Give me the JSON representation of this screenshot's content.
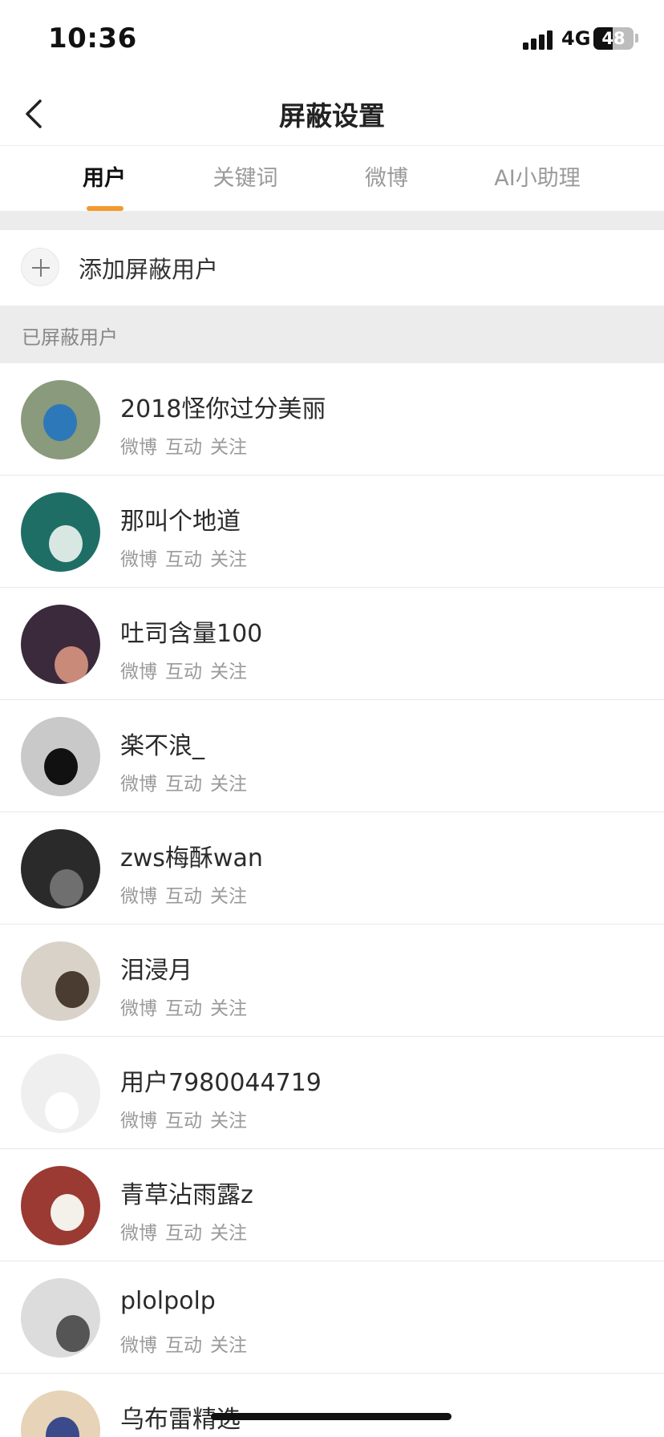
{
  "status_bar": {
    "time": "10:36",
    "network": "4G",
    "battery": "48",
    "battery_level": 0.48
  },
  "nav": {
    "title": "屏蔽设置",
    "back_icon": "chevron-left-icon"
  },
  "tabs": [
    {
      "label": "用户",
      "active": true
    },
    {
      "label": "关键词",
      "active": false
    },
    {
      "label": "微博",
      "active": false
    },
    {
      "label": "AI小助理",
      "active": false
    }
  ],
  "accent_color": "#f39a2c",
  "add_user": {
    "label": "添加屏蔽用户",
    "icon": "plus-icon"
  },
  "section": {
    "title": "已屏蔽用户"
  },
  "users": [
    {
      "name": "2018怪你过分美丽",
      "actions": [
        "微博",
        "互动",
        "关注"
      ],
      "avatar_bg": "#8a9a7c",
      "avatar_accent": "#2d78b8"
    },
    {
      "name": "那叫个地道",
      "actions": [
        "微博",
        "互动",
        "关注"
      ],
      "avatar_bg": "#1f6e66",
      "avatar_accent": "#d9e7e3"
    },
    {
      "name": "吐司含量100",
      "actions": [
        "微博",
        "互动",
        "关注"
      ],
      "avatar_bg": "#3a2a3c",
      "avatar_accent": "#c98a7a"
    },
    {
      "name": "楽不浪_",
      "actions": [
        "微博",
        "互动",
        "关注"
      ],
      "avatar_bg": "#c9c9c9",
      "avatar_accent": "#111111"
    },
    {
      "name": "zws梅酥wan",
      "actions": [
        "微博",
        "互动",
        "关注"
      ],
      "avatar_bg": "#2a2a2a",
      "avatar_accent": "#6f6f6f"
    },
    {
      "name": "泪浸月",
      "actions": [
        "微博",
        "互动",
        "关注"
      ],
      "avatar_bg": "#d8d2c8",
      "avatar_accent": "#4a3c30"
    },
    {
      "name": "用户7980044719",
      "actions": [
        "微博",
        "互动",
        "关注"
      ],
      "avatar_bg": "#efefef",
      "avatar_accent": "#ffffff"
    },
    {
      "name": "青草沾雨露z",
      "actions": [
        "微博",
        "互动",
        "关注"
      ],
      "avatar_bg": "#9a3a32",
      "avatar_accent": "#f3f1ea"
    },
    {
      "name": "plolpolp",
      "actions": [
        "微博",
        "互动",
        "关注"
      ],
      "avatar_bg": "#dcdcdc",
      "avatar_accent": "#555555"
    },
    {
      "name": "乌布雷精选",
      "actions": [],
      "avatar_bg": "#e6d3b8",
      "avatar_accent": "#3a4a8a"
    }
  ]
}
